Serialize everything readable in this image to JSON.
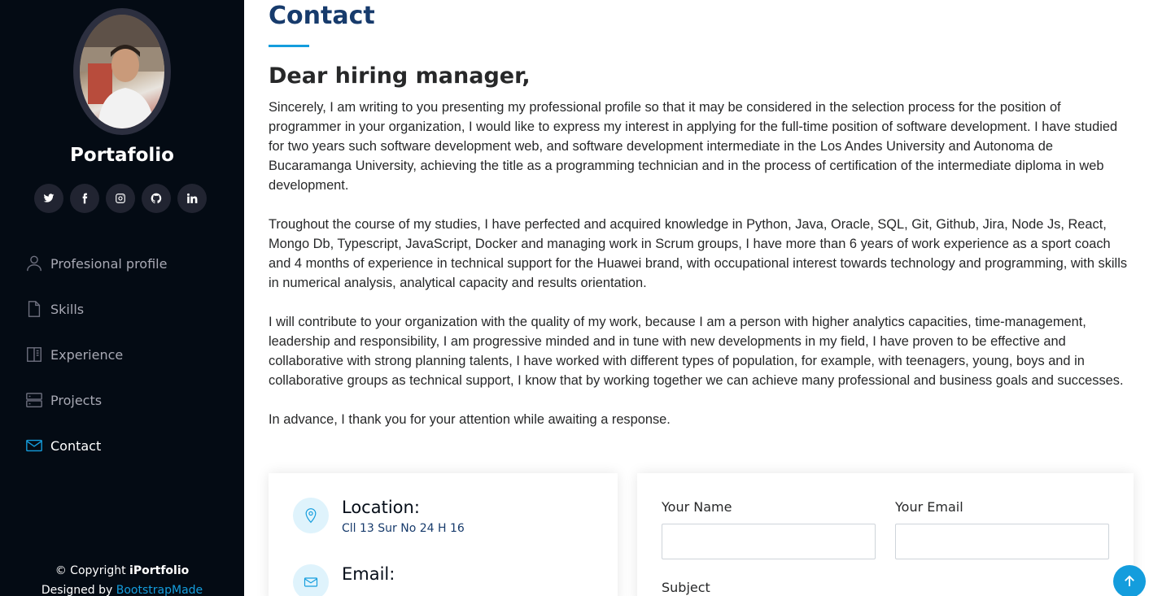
{
  "sidebar": {
    "brand": "Portafolio",
    "avatar_alt": "Profile photo",
    "socials": [
      {
        "icon": "twitter-icon"
      },
      {
        "icon": "facebook-icon"
      },
      {
        "icon": "instagram-icon"
      },
      {
        "icon": "github-icon"
      },
      {
        "icon": "linkedin-icon"
      }
    ],
    "nav": [
      {
        "label": "Profesional profile",
        "icon": "person-icon",
        "active": false
      },
      {
        "label": "Skills",
        "icon": "file-icon",
        "active": false
      },
      {
        "label": "Experience",
        "icon": "book-icon",
        "active": false
      },
      {
        "label": "Projects",
        "icon": "server-icon",
        "active": false
      },
      {
        "label": "Contact",
        "icon": "envelope-icon",
        "active": true
      }
    ],
    "footer": {
      "copyright_prefix": "© Copyright ",
      "copyright_brand": "iPortfolio",
      "designed_prefix": "Designed by ",
      "designed_link": "BootstrapMade"
    }
  },
  "main": {
    "section_title": "Contact",
    "greeting": "Dear hiring manager,",
    "paragraphs": [
      "Sincerely, I am writing to you presenting my professional profile so that it may be considered in the selection process for the position of programmer in your organization, I would like to express my interest in applying for the full-time position of software development. I have studied for two years such software development web, and software development intermediate in the Los Andes University and Autonoma de Bucaramanga University, achieving the title as a programming technician and in the process of certification of the intermediate diploma in web development.",
      "Troughout the course of my studies, I have perfected and acquired knowledge in Python, Java, Oracle, SQL, Git, Github, Jira, Node Js, React, Mongo Db, Typescript, JavaScript, Docker and managing work in Scrum groups, I have more than 6 years of work experience as a sport coach and 4 months of experience in technical support for the Huawei brand, with occupational interest towards technology and programming, with skills in numerical analysis, analytical capacity and results orientation.",
      "I will contribute to your organization with the quality of my work, because I am a person with higher analytics capacities, time-management, leadership and responsibility, I am progressive minded and in tune with new developments in my field, I have proven to be effective and collaborative with strong planning talents, I have worked with different types of population, for example, with teenagers, young, boys and in collaborative groups as technical support, I know that by working together we can achieve many professional and business goals and successes.",
      "In advance, I thank you for your attention while awaiting a response."
    ],
    "info": {
      "location_label": "Location:",
      "location_value": "Cll 13 Sur No 24 H 16",
      "email_label": "Email:"
    },
    "form": {
      "name_label": "Your Name",
      "email_label": "Your Email",
      "subject_label": "Subject",
      "name_value": "",
      "email_value": ""
    }
  },
  "colors": {
    "sidebar_bg": "#040b14",
    "accent": "#149ddd",
    "title": "#173b6c"
  }
}
